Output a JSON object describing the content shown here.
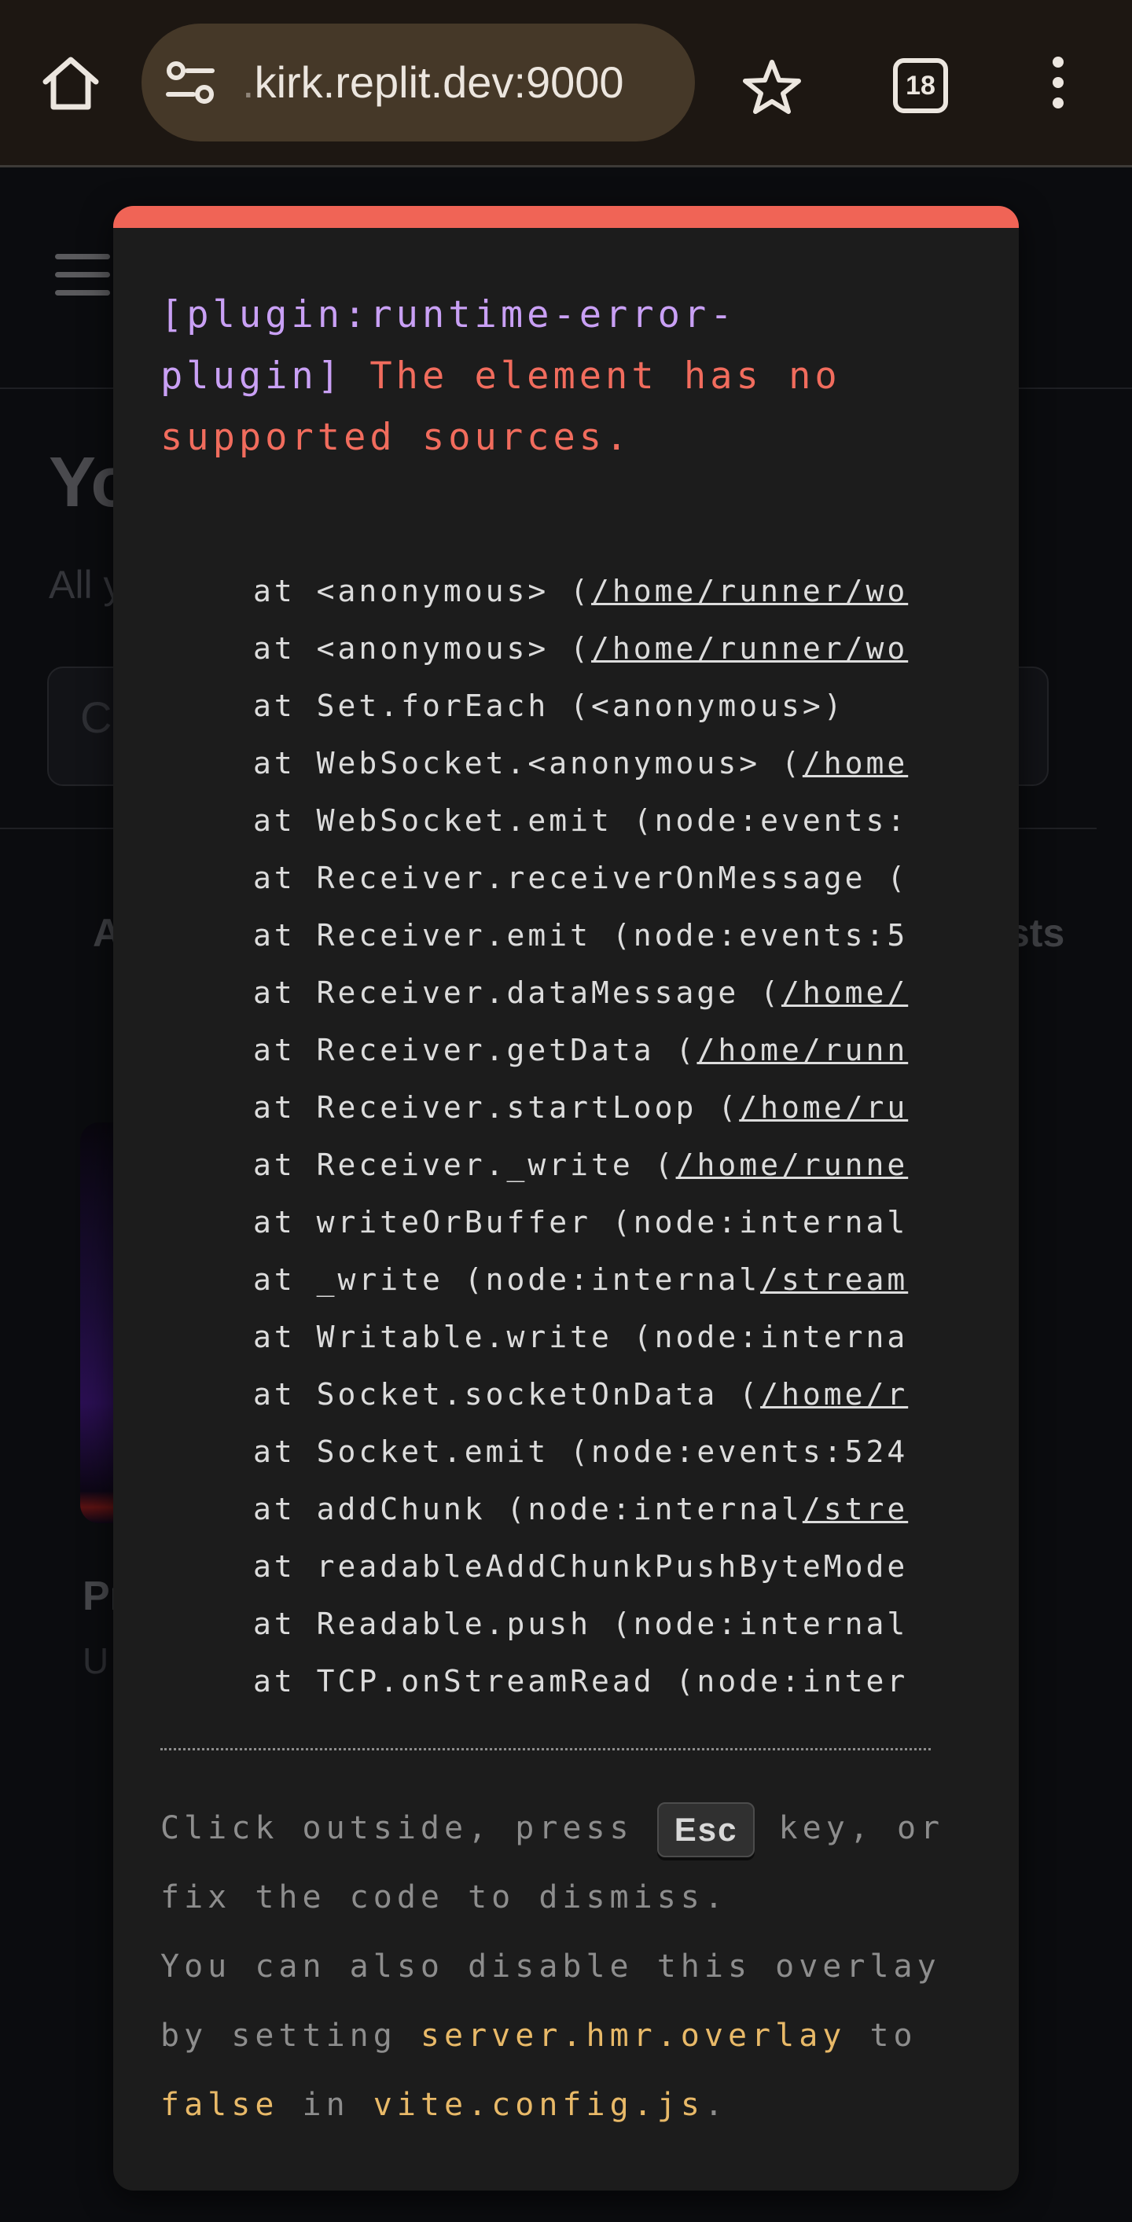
{
  "browser": {
    "url_dim": ".",
    "url_main": "kirk.replit.dev:9000",
    "tab_count": "18",
    "icons": [
      "home-icon",
      "site-settings-icon",
      "bookmark-star-icon",
      "tabs-icon",
      "more-menu-icon"
    ],
    "colors": {
      "toolbar": "#1d1712",
      "urlbar": "#453828"
    }
  },
  "background_page": {
    "heading": "Yo",
    "subtitle": "All y",
    "search_placeholder": "C",
    "tab_left": "A",
    "tab_right": "sts",
    "card_title": "Pr",
    "card_subtitle": "U"
  },
  "overlay": {
    "colors": {
      "accent_bar": "#f06456",
      "plugin": "#c9a0f5",
      "error": "#f16c5d",
      "code": "#e8b968"
    },
    "plugin_label": "[plugin:runtime-error-\nplugin]",
    "error_message": "The element has no\nsupported sources.",
    "stack": [
      {
        "prefix": "at <anonymous> (",
        "file": "/home/runner/wo"
      },
      {
        "prefix": "at <anonymous> (",
        "file": "/home/runner/wo"
      },
      {
        "prefix": "at Set.forEach (<anonymous>)",
        "file": ""
      },
      {
        "prefix": "at WebSocket.<anonymous> (",
        "file": "/home"
      },
      {
        "prefix": "at WebSocket.emit (node:events:",
        "file": ""
      },
      {
        "prefix": "at Receiver.receiverOnMessage (",
        "file": ""
      },
      {
        "prefix": "at Receiver.emit (node:events:5",
        "file": ""
      },
      {
        "prefix": "at Receiver.dataMessage (",
        "file": "/home/"
      },
      {
        "prefix": "at Receiver.getData (",
        "file": "/home/runn"
      },
      {
        "prefix": "at Receiver.startLoop (",
        "file": "/home/ru"
      },
      {
        "prefix": "at Receiver._write (",
        "file": "/home/runne"
      },
      {
        "prefix": "at writeOrBuffer (node:internal",
        "file": ""
      },
      {
        "prefix": "at _write (node:internal",
        "file": "/stream"
      },
      {
        "prefix": "at Writable.write (node:interna",
        "file": ""
      },
      {
        "prefix": "at Socket.socketOnData (",
        "file": "/home/r"
      },
      {
        "prefix": "at Socket.emit (node:events:524",
        "file": ""
      },
      {
        "prefix": "at addChunk (node:internal",
        "file": "/stre"
      },
      {
        "prefix": "at readableAddChunkPushByteMode",
        "file": ""
      },
      {
        "prefix": "at Readable.push (node:internal",
        "file": ""
      },
      {
        "prefix": "at TCP.onStreamRead (node:inter",
        "file": ""
      }
    ],
    "tip": {
      "line1_before": "Click outside, press ",
      "key": "Esc",
      "line1_after": " key, or fix the code to dismiss.",
      "line2_before": "You can also disable this overlay by setting ",
      "config_key": "server.hmr.overlay",
      "line2_middle": " to ",
      "false_value": "false",
      "line2_in": " in ",
      "config_file": "vite.config.js",
      "line2_end": "."
    }
  }
}
